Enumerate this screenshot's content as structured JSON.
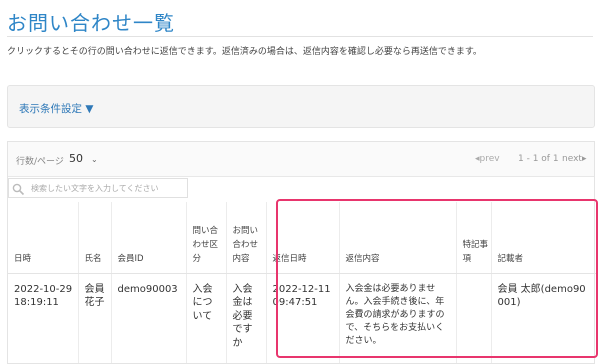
{
  "page": {
    "title": "お問い合わせ一覧",
    "description": "クリックするとその行の問い合わせに返信できます。返信済みの場合は、返信内容を確認し必要なら再送信できます。"
  },
  "filter": {
    "toggle_label": "表示条件設定 ▼"
  },
  "pager": {
    "rows_label": "行数/ページ",
    "rows_value": "50",
    "prev_label": "prev",
    "range_text": "1 - 1 of 1",
    "next_label": "next"
  },
  "search": {
    "placeholder": "検索したい文字を入力してください"
  },
  "table": {
    "headers": [
      "日時",
      "氏名",
      "会員ID",
      "問い合わせ区分",
      "お問い合わせ内容",
      "返信日時",
      "返信内容",
      "特記事項",
      "記載者"
    ],
    "rows": [
      {
        "datetime": "2022-10-29 18:19:11",
        "name": "会員 花子",
        "member_id": "demo90003",
        "category": "入会について",
        "inquiry": "入会金は必要ですか",
        "reply_datetime": "2022-12-11 09:47:51",
        "reply_content": "入会金は必要ありません。入会手続き後に、年会費の請求がありますので、そちらをお支払いください。",
        "notes": "",
        "author": "会員 太郎(demo90001)"
      }
    ]
  },
  "colors": {
    "title": "#2f86c7",
    "link": "#2f79b8",
    "highlight": "#e8356d"
  }
}
